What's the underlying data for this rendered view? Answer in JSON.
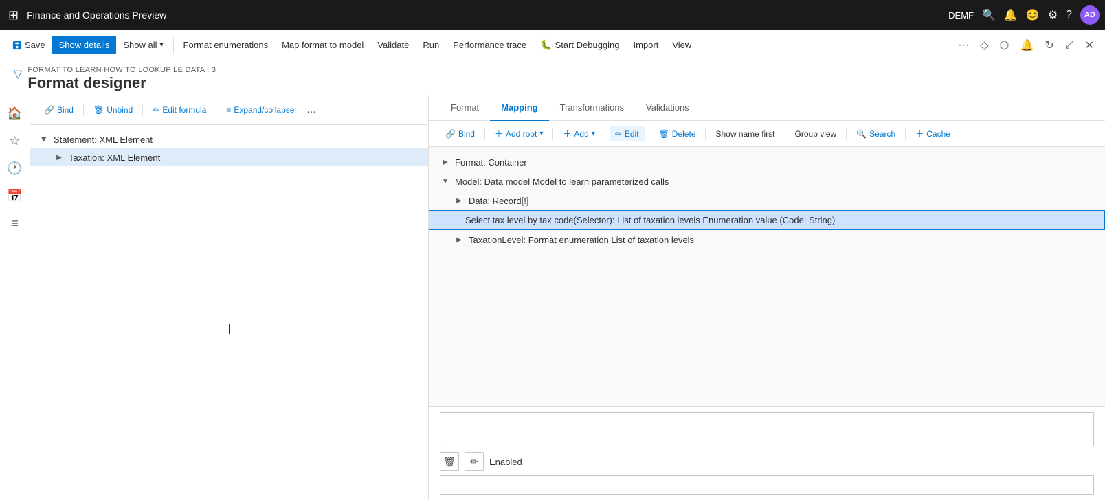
{
  "topbar": {
    "app_title": "Finance and Operations Preview",
    "user": "DEMF",
    "avatar": "AD",
    "icons": [
      "search",
      "bell",
      "face",
      "settings",
      "help"
    ]
  },
  "actionbar": {
    "save_label": "Save",
    "show_details_label": "Show details",
    "show_all_label": "Show all",
    "format_enumerations_label": "Format enumerations",
    "map_format_label": "Map format to model",
    "validate_label": "Validate",
    "run_label": "Run",
    "performance_trace_label": "Performance trace",
    "start_debugging_label": "Start Debugging",
    "import_label": "Import",
    "view_label": "View"
  },
  "page": {
    "breadcrumb": "FORMAT TO LEARN HOW TO LOOKUP LE DATA : 3",
    "title": "Format designer"
  },
  "left_panel": {
    "toolbar": {
      "bind_label": "Bind",
      "unbind_label": "Unbind",
      "edit_formula_label": "Edit formula",
      "expand_collapse_label": "Expand/collapse",
      "more": "..."
    },
    "tree": [
      {
        "id": 1,
        "label": "Statement: XML Element",
        "level": 0,
        "expanded": true,
        "selected": false
      },
      {
        "id": 2,
        "label": "Taxation: XML Element",
        "level": 1,
        "expanded": false,
        "selected": true
      }
    ]
  },
  "right_panel": {
    "tabs": [
      {
        "id": "format",
        "label": "Format",
        "active": false
      },
      {
        "id": "mapping",
        "label": "Mapping",
        "active": true
      },
      {
        "id": "transformations",
        "label": "Transformations",
        "active": false
      },
      {
        "id": "validations",
        "label": "Validations",
        "active": false
      }
    ],
    "toolbar": {
      "bind_label": "Bind",
      "add_root_label": "Add root",
      "add_label": "Add",
      "edit_label": "Edit",
      "delete_label": "Delete",
      "show_name_first_label": "Show name first",
      "group_view_label": "Group view",
      "search_label": "Search",
      "cache_label": "Cache"
    },
    "data_tree": [
      {
        "id": 1,
        "label": "Format: Container",
        "level": 0,
        "expanded": false,
        "selected": false,
        "highlighted": false
      },
      {
        "id": 2,
        "label": "Model: Data model Model to learn parameterized calls",
        "level": 0,
        "expanded": true,
        "selected": false,
        "highlighted": false
      },
      {
        "id": 3,
        "label": "Data: Record[!]",
        "level": 1,
        "expanded": false,
        "selected": false,
        "highlighted": false
      },
      {
        "id": 4,
        "label": "Select tax level by tax code(Selector): List of taxation levels Enumeration value (Code: String)",
        "level": 2,
        "expanded": false,
        "selected": false,
        "highlighted": true
      },
      {
        "id": 5,
        "label": "TaxationLevel: Format enumeration List of taxation levels",
        "level": 1,
        "expanded": false,
        "selected": false,
        "highlighted": false
      }
    ]
  },
  "bottom": {
    "enabled_label": "Enabled",
    "delete_icon": "🗑",
    "edit_icon": "✏"
  }
}
